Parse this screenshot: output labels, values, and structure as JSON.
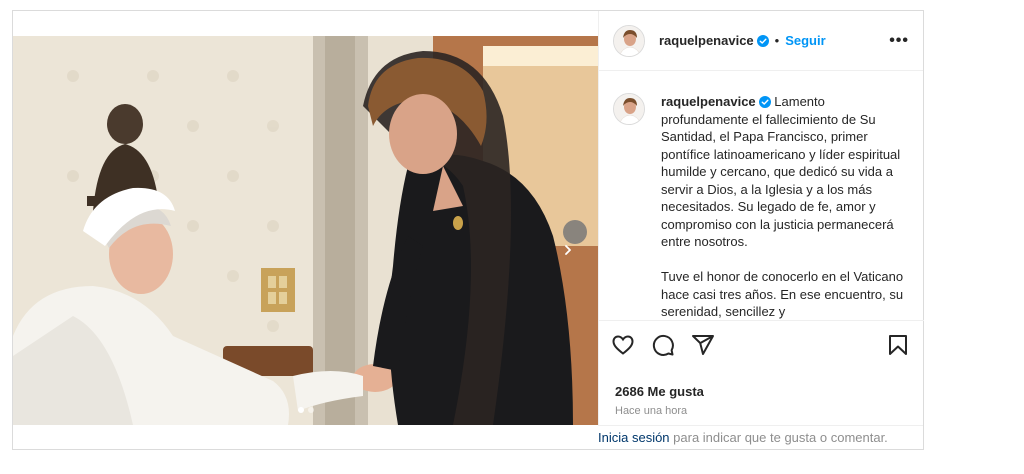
{
  "post": {
    "username": "raquelpenavice",
    "separator": "•",
    "follow_label": "Seguir",
    "more_label": "•••",
    "caption_paragraphs": [
      "Lamento profundamente el fallecimiento de Su Santidad, el Papa Francisco, primer pontífice latinoamericano y líder espiritual humilde y cercano, que dedicó su vida a servir a Dios, a la Iglesia y a los más necesitados. Su legado de fe, amor y compromiso con la justicia permanecerá entre nosotros.",
      "Tuve el honor de conocerlo en el Vaticano hace casi tres años. En ese encuentro, su serenidad, sencillez y"
    ],
    "likes": "2686 Me gusta",
    "time": "Hace una hora",
    "footer": {
      "login_label": "Inicia sesión",
      "rest": " para indicar que te gusta o comentar."
    }
  },
  "icons": [
    "verified-badge-icon",
    "heart-icon",
    "comment-icon",
    "share-icon",
    "bookmark-icon",
    "chevron-right-icon"
  ],
  "colors": {
    "accent": "#0095f6",
    "text": "#262626",
    "muted": "#8e8e8e",
    "border": "#dbdbdb"
  }
}
